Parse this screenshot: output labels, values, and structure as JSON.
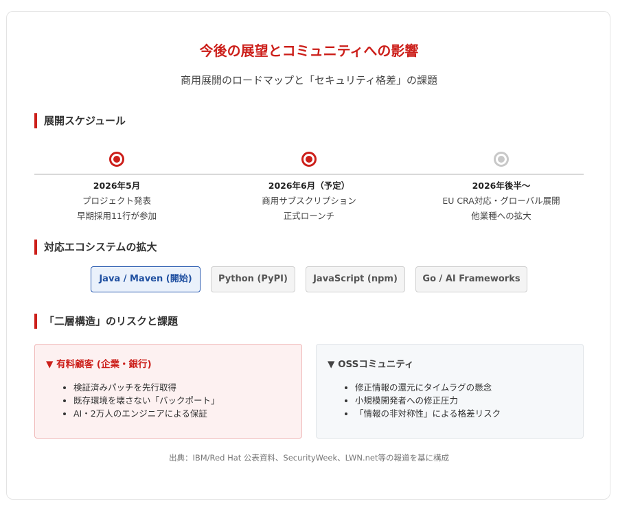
{
  "header": {
    "title": "今後の展望とコミュニティへの影響",
    "subtitle": "商用展開のロードマップと「セキュリティ格差」の課題"
  },
  "sections": {
    "schedule": "展開スケジュール",
    "ecosystem": "対応エコシステムの拡大",
    "risks": "「二層構造」のリスクと課題"
  },
  "timeline": [
    {
      "date": "2026年5月",
      "line1": "プロジェクト発表",
      "line2": "早期採用11行が参加",
      "status": "done"
    },
    {
      "date": "2026年6月（予定）",
      "line1": "商用サブスクリプション",
      "line2": "正式ローンチ",
      "status": "done"
    },
    {
      "date": "2026年後半〜",
      "line1": "EU CRA対応・グローバル展開",
      "line2": "他業種への拡大",
      "status": "future"
    }
  ],
  "ecosystems": [
    {
      "label": "Java / Maven (開始)",
      "active": true
    },
    {
      "label": "Python (PyPI)",
      "active": false
    },
    {
      "label": "JavaScript (npm)",
      "active": false
    },
    {
      "label": "Go / AI Frameworks",
      "active": false
    }
  ],
  "tiers": {
    "paid": {
      "title": "▼ 有料顧客 (企業・銀行)",
      "items": [
        "検証済みパッチを先行取得",
        "既存環境を壊さない「バックポート」",
        "AI・2万人のエンジニアによる保証"
      ]
    },
    "oss": {
      "title": "▼ OSSコミュニティ",
      "items": [
        "修正情報の還元にタイムラグの懸念",
        "小規模開発者への修正圧力",
        "「情報の非対称性」による格差リスク"
      ]
    }
  },
  "footer": {
    "source": "出典：IBM/Red Hat 公表資料、SecurityWeek、LWN.net等の報道を基に構成"
  },
  "colors": {
    "accent": "#cc1f1a",
    "active_chip": "#1f4fa0",
    "future_dot": "#c8c8c8"
  }
}
